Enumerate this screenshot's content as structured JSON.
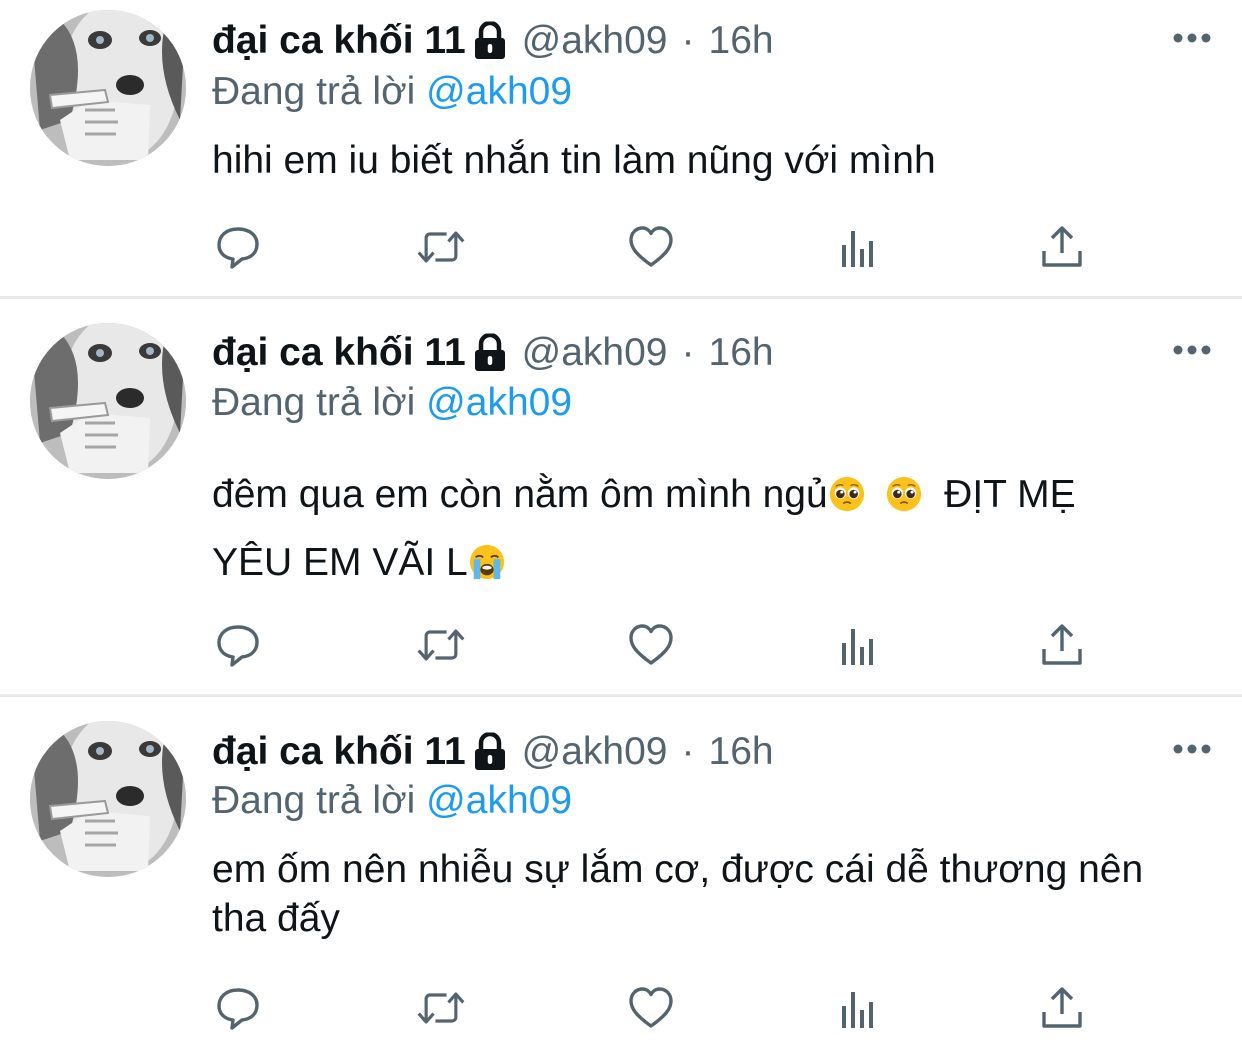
{
  "tweets": [
    {
      "display_name": "đại ca khối 11",
      "handle": "@akh09",
      "separator": "·",
      "time": "16h",
      "reply_prefix": "Đang trả lời",
      "reply_to": "@akh09",
      "text": "hihi em iu biết nhắn tin làm nũng với mình",
      "avatar_icon": "husky-dog-avatar",
      "lock_icon": "lock-icon"
    },
    {
      "display_name": "đại ca khối 11",
      "handle": "@akh09",
      "separator": "·",
      "time": "16h",
      "reply_prefix": "Đang trả lời",
      "reply_to": "@akh09",
      "text_line1_a": "đêm qua em còn nằm ôm mình ngủ",
      "text_line1_b": "  ĐỊT MẸ",
      "text_line2": "YÊU EM VÃI L",
      "emojis": [
        "pleading-face-emoji",
        "pleading-face-emoji",
        "loudly-crying-face-emoji"
      ],
      "avatar_icon": "husky-dog-avatar",
      "lock_icon": "lock-icon"
    },
    {
      "display_name": "đại ca khối 11",
      "handle": "@akh09",
      "separator": "·",
      "time": "16h",
      "reply_prefix": "Đang trả lời",
      "reply_to": "@akh09",
      "text": "em ốm nên nhiễu sự lắm cơ, được cái dễ thương nên tha đấy",
      "avatar_icon": "husky-dog-avatar",
      "lock_icon": "lock-icon"
    }
  ],
  "actions": [
    "reply-icon",
    "retweet-icon",
    "like-icon",
    "analytics-icon",
    "share-icon"
  ],
  "colors": {
    "text": "#0f1419",
    "secondary": "#536471",
    "accent": "#1d9bf0",
    "divider": "#e7e9ea"
  }
}
